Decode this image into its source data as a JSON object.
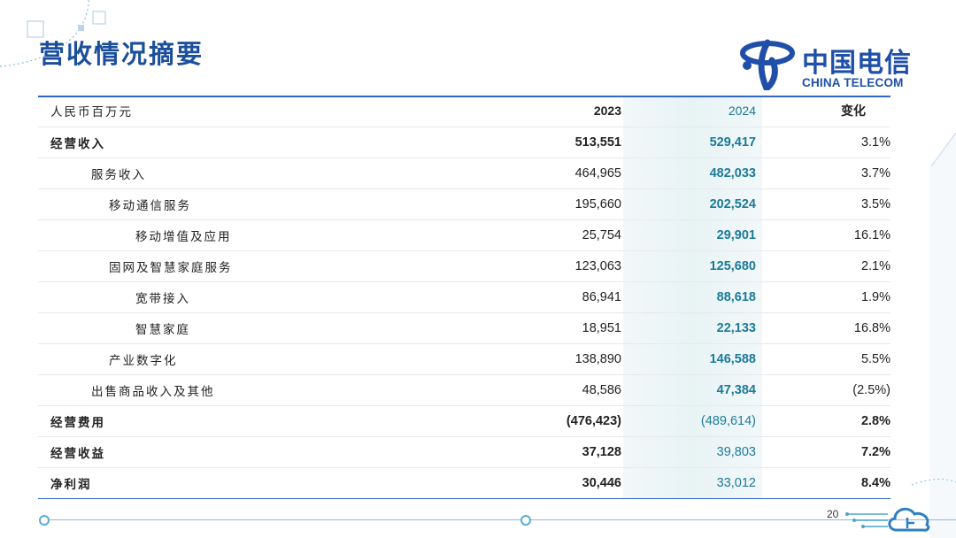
{
  "title": "营收情况摘要",
  "logo": {
    "cn": "中国电信",
    "en": "CHINA TELECOM"
  },
  "table": {
    "header": {
      "label": "人民币百万元",
      "y2023": "2023",
      "y2024": "2024",
      "change": "变化"
    },
    "rows": [
      {
        "label": "经营收入",
        "y2023": "513,551",
        "y2024": "529,417",
        "change": "3.1%"
      },
      {
        "label": "服务收入",
        "y2023": "464,965",
        "y2024": "482,033",
        "change": "3.7%"
      },
      {
        "label": "移动通信服务",
        "y2023": "195,660",
        "y2024": "202,524",
        "change": "3.5%"
      },
      {
        "label": "移动增值及应用",
        "y2023": "25,754",
        "y2024": "29,901",
        "change": "16.1%"
      },
      {
        "label": "固网及智慧家庭服务",
        "y2023": "123,063",
        "y2024": "125,680",
        "change": "2.1%"
      },
      {
        "label": "宽带接入",
        "y2023": "86,941",
        "y2024": "88,618",
        "change": "1.9%"
      },
      {
        "label": "智慧家庭",
        "y2023": "18,951",
        "y2024": "22,133",
        "change": "16.8%"
      },
      {
        "label": "产业数字化",
        "y2023": "138,890",
        "y2024": "146,588",
        "change": "5.5%"
      },
      {
        "label": "出售商品收入及其他",
        "y2023": "48,586",
        "y2024": "47,384",
        "change": "(2.5%)"
      },
      {
        "label": "经营费用",
        "y2023": "(476,423)",
        "y2024": "(489,614)",
        "change": "2.8%"
      },
      {
        "label": "经营收益",
        "y2023": "37,128",
        "y2024": "39,803",
        "change": "7.2%"
      },
      {
        "label": "净利润",
        "y2023": "30,446",
        "y2024": "33,012",
        "change": "8.4%"
      }
    ]
  },
  "page_number": "20",
  "colors": {
    "title": "#1b4f9c",
    "accent_2024": "#1c7a9a",
    "rule": "#2f66c8"
  }
}
